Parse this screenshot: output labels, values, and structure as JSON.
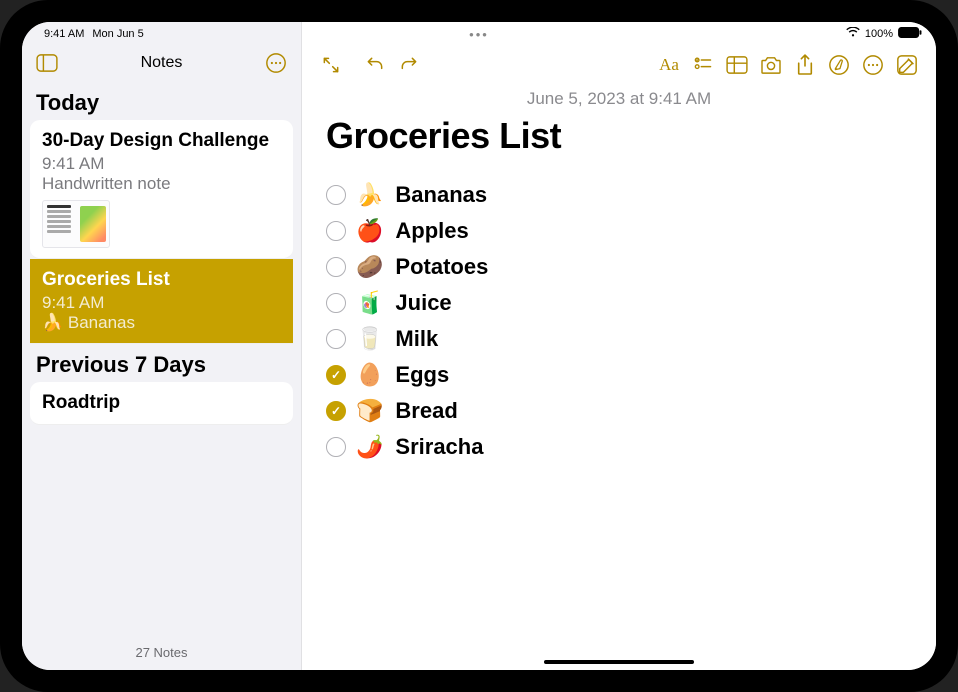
{
  "status": {
    "time": "9:41 AM",
    "date": "Mon Jun 5",
    "battery_percent": "100%"
  },
  "sidebar": {
    "title": "Notes",
    "sections": {
      "today_label": "Today",
      "prev7_label": "Previous 7 Days"
    },
    "notes": [
      {
        "title": "30-Day Design Challenge",
        "time": "9:41 AM",
        "preview": "Handwritten note"
      },
      {
        "title": "Groceries List",
        "time": "9:41 AM",
        "preview": "🍌 Bananas"
      },
      {
        "title": "Roadtrip"
      }
    ],
    "footer": "27 Notes"
  },
  "note": {
    "datetime": "June 5, 2023 at 9:41 AM",
    "title": "Groceries List",
    "items": [
      {
        "emoji": "🍌",
        "text": "Bananas",
        "checked": false
      },
      {
        "emoji": "🍎",
        "text": "Apples",
        "checked": false
      },
      {
        "emoji": "🥔",
        "text": "Potatoes",
        "checked": false
      },
      {
        "emoji": "🧃",
        "text": "Juice",
        "checked": false
      },
      {
        "emoji": "🥛",
        "text": "Milk",
        "checked": false
      },
      {
        "emoji": "🥚",
        "text": "Eggs",
        "checked": true
      },
      {
        "emoji": "🍞",
        "text": "Bread",
        "checked": true
      },
      {
        "emoji": "🌶️",
        "text": "Sriracha",
        "checked": false
      }
    ]
  }
}
